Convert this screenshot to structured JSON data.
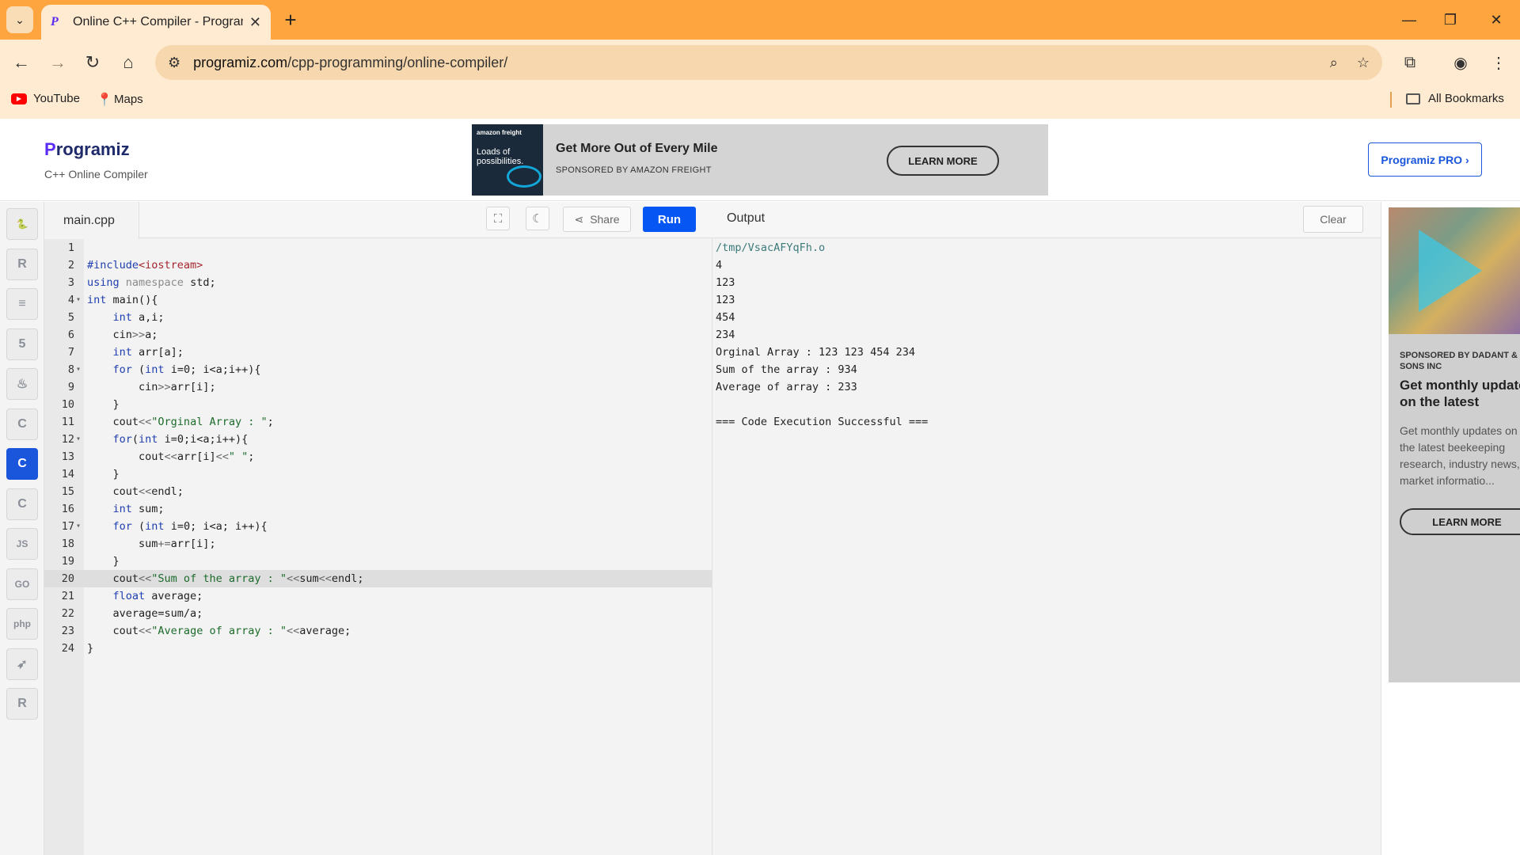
{
  "browser": {
    "tab_title": "Online C++ Compiler - Programiz",
    "url_host": "programiz.com",
    "url_path": "/cpp-programming/online-compiler/",
    "bookmarks": [
      "YouTube",
      "Maps"
    ],
    "all_bookmarks": "All Bookmarks"
  },
  "header": {
    "logo": "rogramiz",
    "logo_p": "P",
    "subtitle": "C++ Online Compiler",
    "pro_button": "Programiz PRO ›"
  },
  "top_ad": {
    "image_text": "Loads of possibilities.",
    "image_brand": "amazon freight",
    "title": "Get More Out of Every Mile",
    "sponsor": "SPONSORED BY AMAZON FREIGHT",
    "cta": "LEARN MORE"
  },
  "sidebar": {
    "languages": [
      {
        "name": "python",
        "glyph": "🐍"
      },
      {
        "name": "r",
        "glyph": "R"
      },
      {
        "name": "sql",
        "glyph": "≡"
      },
      {
        "name": "html",
        "glyph": "5"
      },
      {
        "name": "java",
        "glyph": "♨"
      },
      {
        "name": "c",
        "glyph": "C"
      },
      {
        "name": "cpp",
        "glyph": "C"
      },
      {
        "name": "csharp",
        "glyph": "C"
      },
      {
        "name": "js",
        "glyph": "JS"
      },
      {
        "name": "go",
        "glyph": "GO"
      },
      {
        "name": "php",
        "glyph": "php"
      },
      {
        "name": "swift",
        "glyph": "➶"
      },
      {
        "name": "rust",
        "glyph": "R"
      }
    ]
  },
  "editor": {
    "file_name": "main.cpp",
    "share_label": "Share",
    "run_label": "Run",
    "lines": [
      "",
      "#include<iostream>",
      "using namespace std;",
      "int main(){",
      "    int a,i;",
      "    cin>>a;",
      "    int arr[a];",
      "    for (int i=0; i<a;i++){",
      "        cin>>arr[i];",
      "    }",
      "    cout<<\"Orginal Array : \";",
      "    for(int i=0;i<a;i++){",
      "        cout<<arr[i]<<\" \";",
      "    }",
      "    cout<<endl;",
      "    int sum;",
      "    for (int i=0; i<a; i++){",
      "        sum+=arr[i];",
      "    }",
      "    cout<<\"Sum of the array : \"<<sum<<endl;",
      "    float average;",
      "    average=sum/a;",
      "    cout<<\"Average of array : \"<<average;",
      "}"
    ],
    "active_line": 20,
    "fold_lines": [
      4,
      8,
      12,
      17
    ]
  },
  "output": {
    "title": "Output",
    "clear_label": "Clear",
    "lines": [
      "/tmp/VsacAFYqFh.o",
      "4",
      "123",
      "123",
      "454",
      "234",
      "Orginal Array : 123 123 454 234",
      "Sum of the array : 934",
      "Average of array : 233",
      "",
      "=== Code Execution Successful ==="
    ]
  },
  "side_ad": {
    "sponsor": "SPONSORED BY DADANT & SONS INC",
    "headline": "Get monthly updates on the latest",
    "body": "Get monthly updates on the latest beekeeping research, industry news, market informatio...",
    "cta": "LEARN MORE"
  },
  "colors": {
    "chrome_accent": "#ffa53f",
    "run_button": "#0556f3",
    "active_lang": "#1a56db"
  }
}
